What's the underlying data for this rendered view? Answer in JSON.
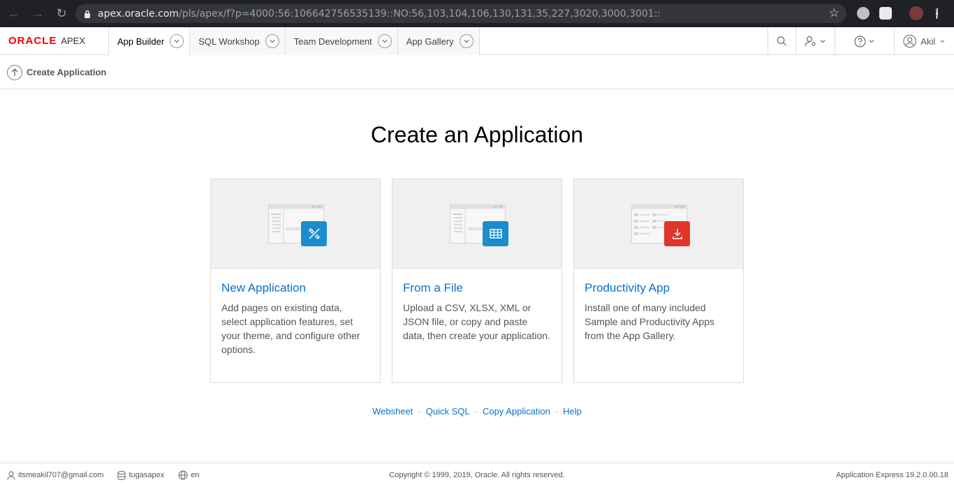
{
  "browser": {
    "url_domain": "apex.oracle.com",
    "url_path": "/pls/apex/f?p=4000:56:106642756535139::NO:56,103,104,106,130,131,35,227,3020,3000,3001::"
  },
  "header": {
    "logo_oracle": "ORACLE",
    "logo_apex": "APEX",
    "tabs": [
      {
        "label": "App Builder"
      },
      {
        "label": "SQL Workshop"
      },
      {
        "label": "Team Development"
      },
      {
        "label": "App Gallery"
      }
    ],
    "user_name": "Akil"
  },
  "breadcrumb": {
    "label": "Create Application"
  },
  "main": {
    "title": "Create an Application",
    "cards": [
      {
        "title": "New Application",
        "description": "Add pages on existing data, select application features, set your theme, and configure other options.",
        "badge_color": "#1b8dcf",
        "icon": "tools-icon"
      },
      {
        "title": "From a File",
        "description": "Upload a CSV, XLSX, XML or JSON file, or copy and paste data, then create your application.",
        "badge_color": "#1b8dcf",
        "icon": "grid-table-icon"
      },
      {
        "title": "Productivity App",
        "description": "Install one of many included Sample and Productivity Apps from the App Gallery.",
        "badge_color": "#e0352b",
        "icon": "download-icon"
      }
    ],
    "links": [
      "Websheet",
      "Quick SQL",
      "Copy Application",
      "Help"
    ]
  },
  "footer": {
    "email": "itsmeakil707@gmail.com",
    "workspace": "tugasapex",
    "language": "en",
    "copyright": "Copyright © 1999, 2019, Oracle. All rights reserved.",
    "version": "Application Express 19.2.0.00.18"
  }
}
